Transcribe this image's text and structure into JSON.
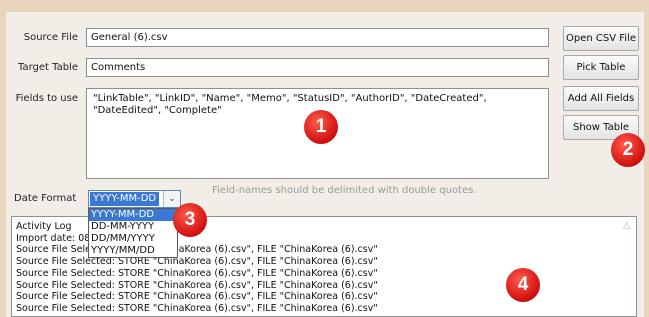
{
  "form": {
    "source_file_label": "Source File",
    "source_file_value": "General (6).csv",
    "target_table_label": "Target Table",
    "target_table_value": "Comments",
    "fields_label": "Fields to use",
    "fields_value": "\"LinkTable\", \"LinkID\", \"Name\", \"Memo\", \"StatusID\", \"AuthorID\", \"DateCreated\", \"DateEdited\", \"Complete\"",
    "hint": "Field-names should be delimited with double quotes.",
    "date_format_label": "Date Format",
    "date_format_value": "YYYY-MM-DD",
    "date_format_options": [
      "YYYY-MM-DD",
      "DD-MM-YYYY",
      "DD/MM/YYYY",
      "YYYY/MM/DD"
    ]
  },
  "buttons": {
    "open_csv": "Open CSV File",
    "pick_table": "Pick Table",
    "add_all_fields": "Add All Fields",
    "show_table": "Show Table"
  },
  "log": {
    "lines": [
      "Activity Log",
      "Import date: 08",
      "Source File Selected: STORE \"ChinaKorea (6).csv\", FILE \"ChinaKorea (6).csv\"",
      "Source File Selected: STORE \"ChinaKorea (6).csv\", FILE \"ChinaKorea (6).csv\"",
      "Source File Selected: STORE \"ChinaKorea (6).csv\", FILE \"ChinaKorea (6).csv\"",
      "Source File Selected: STORE \"ChinaKorea (6).csv\", FILE \"ChinaKorea (6).csv\"",
      "Source File Selected: STORE \"ChinaKorea (6).csv\", FILE \"ChinaKorea (6).csv\"",
      "Source File Selected: STORE \"ChinaKorea (6).csv\", FILE \"ChinaKorea (6).csv\""
    ]
  },
  "annotations": [
    "1",
    "2",
    "3",
    "4"
  ],
  "colors": {
    "badge": "#d10f0f",
    "selection": "#3a78d4",
    "window_frame": "#e9d4bd"
  }
}
